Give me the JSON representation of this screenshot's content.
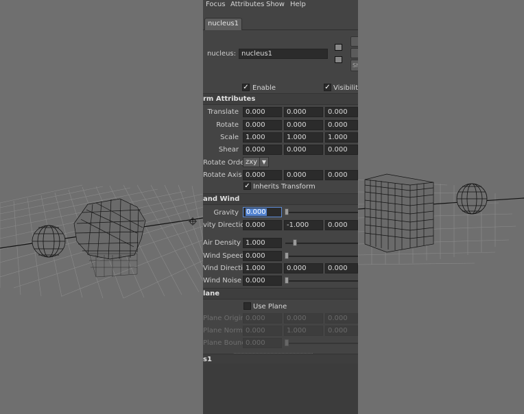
{
  "menu": [
    "Focus",
    "Attributes",
    "Show",
    "Help"
  ],
  "tab_label": "nucleus1",
  "node": {
    "label": "nucleus:",
    "value": "nucleus1"
  },
  "side_button_label": "Sh",
  "enable": {
    "label": "Enable",
    "checked": true
  },
  "visibility": {
    "label": "Visibility",
    "checked": true
  },
  "sections": {
    "transform": "rm Attributes",
    "gravity": "and Wind",
    "ground": "lane",
    "footer": "s1"
  },
  "transform_rows": [
    {
      "label": "Translate",
      "values": [
        "0.000",
        "0.000",
        "0.000"
      ]
    },
    {
      "label": "Rotate",
      "values": [
        "0.000",
        "0.000",
        "0.000"
      ]
    },
    {
      "label": "Scale",
      "values": [
        "1.000",
        "1.000",
        "1.000"
      ]
    },
    {
      "label": "Shear",
      "values": [
        "0.000",
        "0.000",
        "0.000"
      ]
    }
  ],
  "rotate_order": {
    "label": "Rotate Order",
    "value": "zxy"
  },
  "rotate_axis": {
    "label": "Rotate Axis",
    "values": [
      "0.000",
      "0.000",
      "0.000"
    ]
  },
  "inherits": {
    "label": "Inherits Transform",
    "checked": true
  },
  "gravity": {
    "label": "Gravity",
    "value": "0.000"
  },
  "gravity_direction": {
    "label": "vity Direction",
    "values": [
      "0.000",
      "-1.000",
      "0.000"
    ]
  },
  "air_density": {
    "label": "Air Density",
    "value": "1.000"
  },
  "wind_speed": {
    "label": "Wind Speed",
    "value": "0.000"
  },
  "wind_direction": {
    "label": "Vind Direction",
    "values": [
      "1.000",
      "0.000",
      "0.000"
    ]
  },
  "wind_noise": {
    "label": "Wind Noise",
    "value": "0.000"
  },
  "use_plane": {
    "label": "Use Plane",
    "checked": false
  },
  "plane_origin": {
    "label": "Plane Origin",
    "values": [
      "0.000",
      "0.000",
      "0.000"
    ]
  },
  "plane_normal": {
    "label": "Plane Normal",
    "values": [
      "0.000",
      "1.000",
      "0.000"
    ]
  },
  "plane_bounce": {
    "label": "Plane Bounce",
    "value": "0.000"
  },
  "colors": {
    "panel": "#444444",
    "field": "#2b2b2b",
    "viewport": "#6f6f6f",
    "selection": "#5283d1"
  }
}
